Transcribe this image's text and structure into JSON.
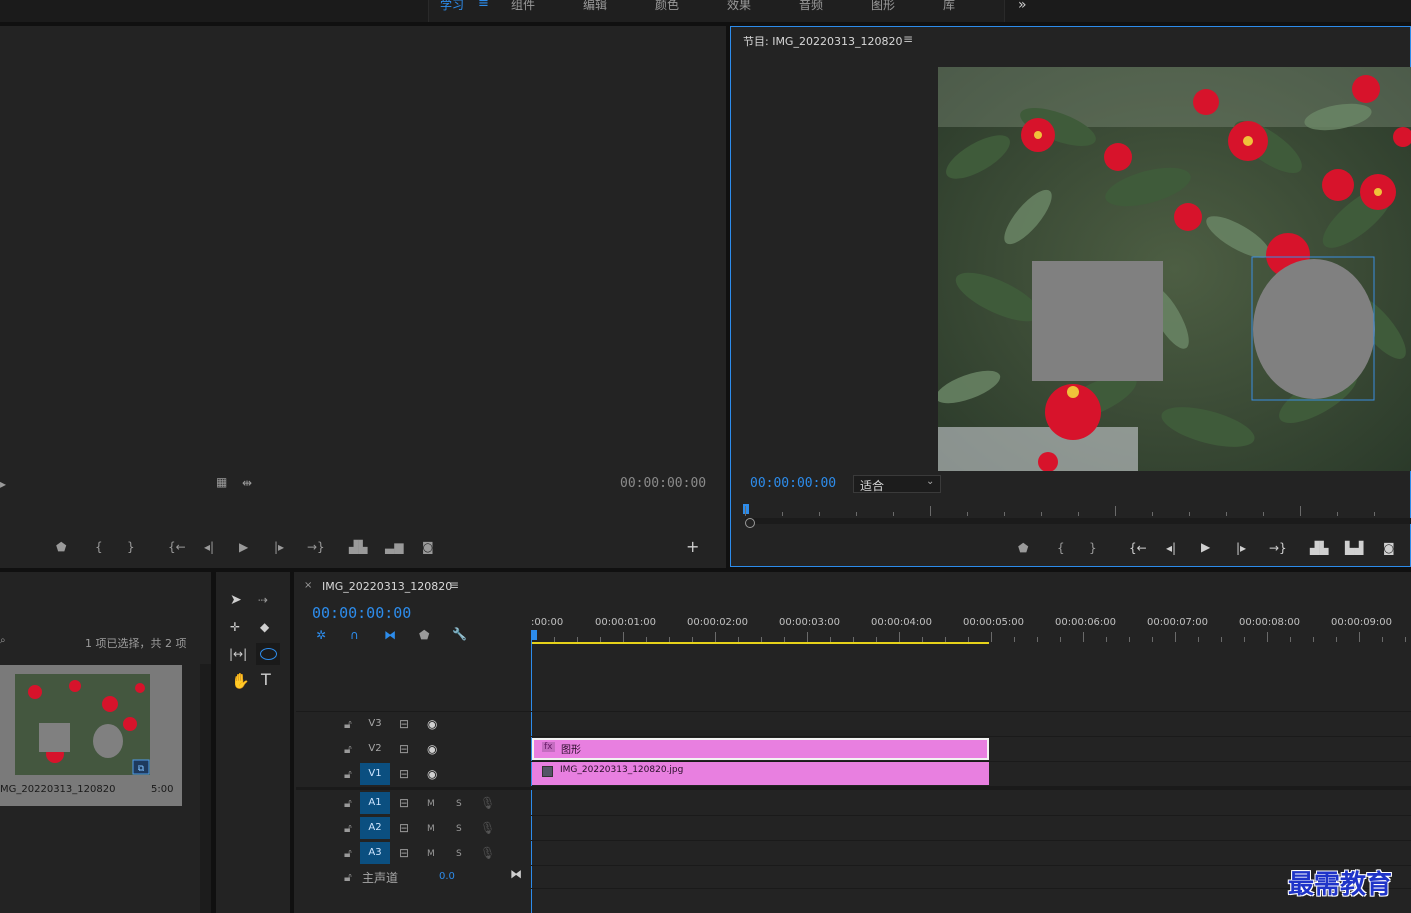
{
  "workspace_tabs": [
    "学习",
    "组件",
    "编辑",
    "颜色",
    "效果",
    "音频",
    "图形",
    "库"
  ],
  "workspace_menu_icon": "hamburger-icon",
  "workspace_overflow": "»",
  "source_monitor": {
    "timecode": "00:00:00:00"
  },
  "program_monitor": {
    "title": "节目: IMG_20220313_120820",
    "timecode": "00:00:00:00",
    "fit_value": "适合"
  },
  "project_panel": {
    "selection_status": "1 项已选择，共 2 项",
    "item_name": "MG_20220313_120820",
    "item_duration": "5:00"
  },
  "timeline": {
    "sequence_name": "IMG_20220313_120820",
    "close_label": "×",
    "timecode": "00:00:00:00",
    "ruler_labels": [
      ":00:00",
      "00:00:01:00",
      "00:00:02:00",
      "00:00:03:00",
      "00:00:04:00",
      "00:00:05:00",
      "00:00:06:00",
      "00:00:07:00",
      "00:00:08:00",
      "00:00:09:00"
    ],
    "video_tracks": [
      "V3",
      "V2",
      "V1"
    ],
    "audio_tracks": [
      "A1",
      "A2",
      "A3"
    ],
    "mute_label": "M",
    "solo_label": "S",
    "master_label": "主声道",
    "master_value": "0.0",
    "clips": {
      "graphic": "图形",
      "image": "IMG_20220313_120820.jpg"
    }
  },
  "watermark": "最需教育",
  "colors": {
    "accent": "#2d8ceb",
    "clip_pink": "#e87fe0",
    "track_selected": "#0b4f80",
    "work_area": "#e6d21a"
  }
}
